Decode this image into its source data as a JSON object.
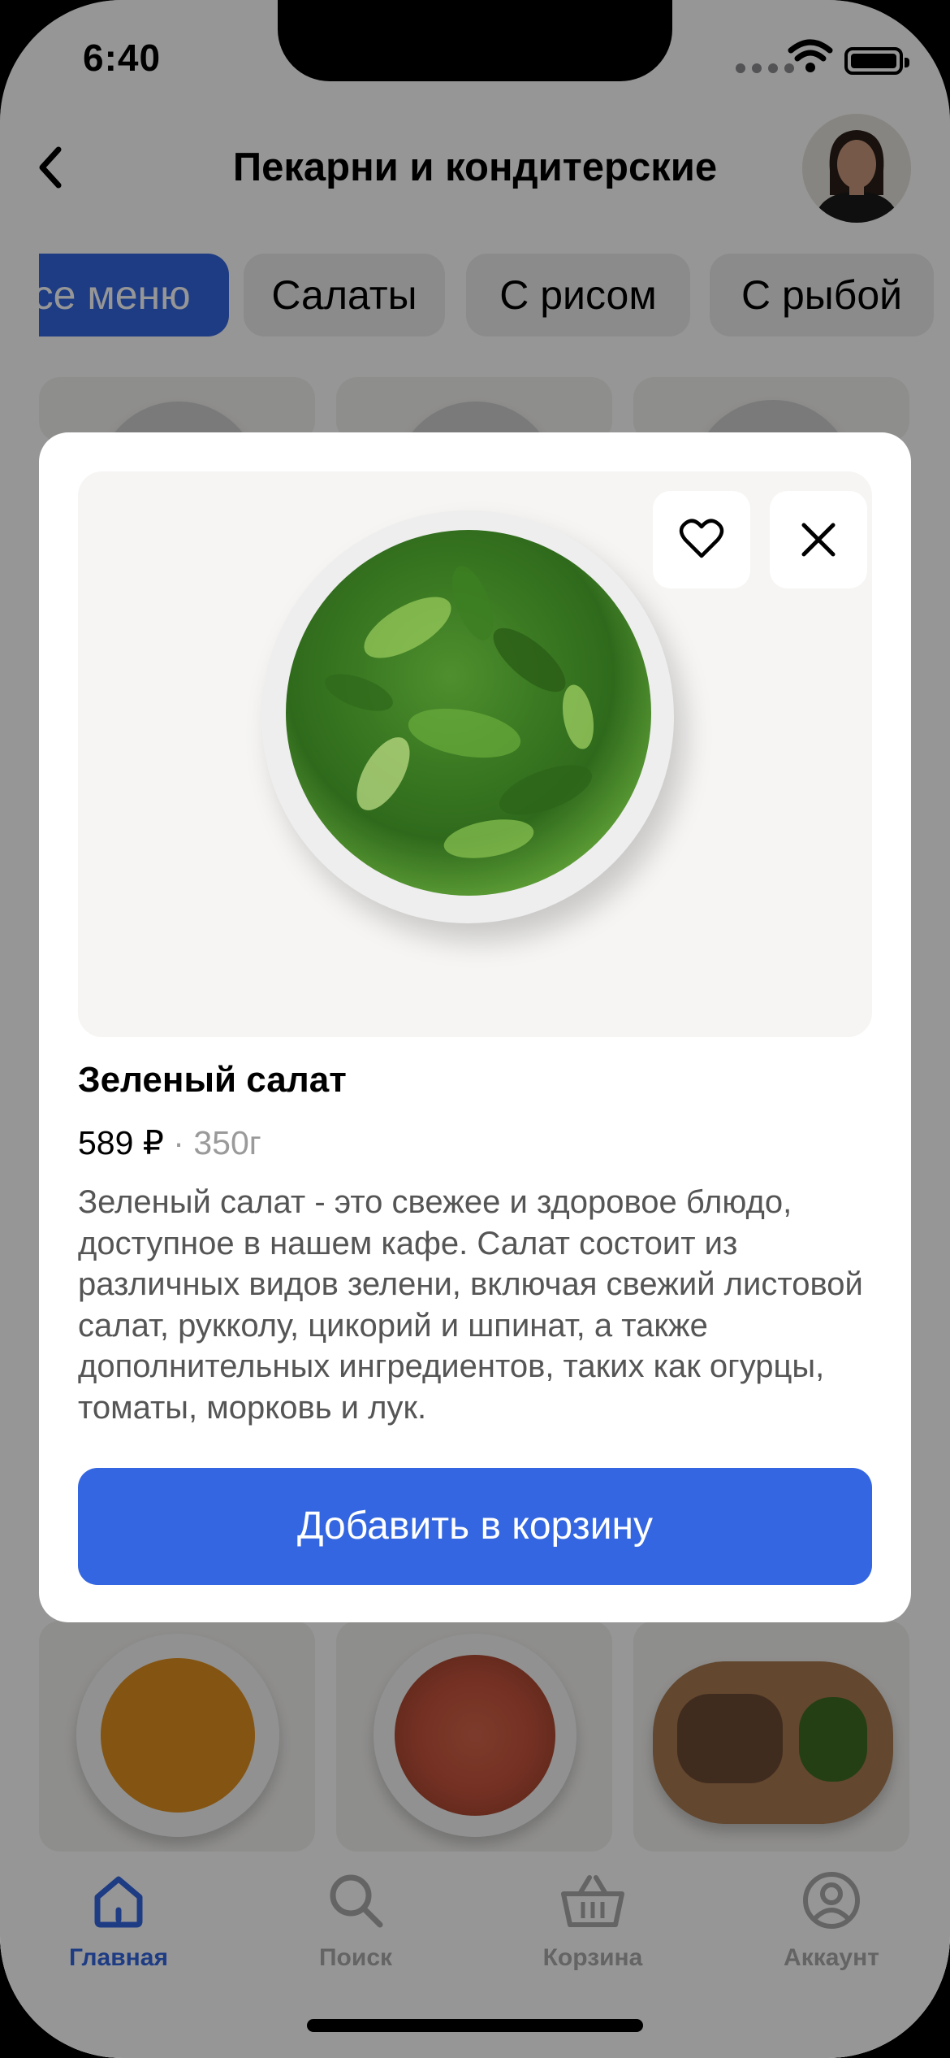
{
  "status_bar": {
    "time": "6:40"
  },
  "header": {
    "title": "Пекарни и кондитерские"
  },
  "categories": [
    {
      "label": "Все меню",
      "active": true
    },
    {
      "label": "Салаты",
      "active": false
    },
    {
      "label": "С рисом",
      "active": false
    },
    {
      "label": "С рыбой",
      "active": false
    }
  ],
  "modal": {
    "dish_name": "Зеленый салат",
    "price": "589 ₽",
    "separator": "·",
    "weight": "350г",
    "description": "Зеленый салат - это свежее и здоровое блюдо, доступное в нашем кафе. Салат состоит из различных видов зелени, включая свежий листовой салат, рукколу, цикорий и шпинат, а также дополнительных ингредиентов, таких как огурцы, томаты, морковь и лук.",
    "add_button": "Добавить в корзину"
  },
  "tabs": [
    {
      "label": "Главная",
      "icon": "home-icon",
      "active": true
    },
    {
      "label": "Поиск",
      "icon": "search-icon",
      "active": false
    },
    {
      "label": "Корзина",
      "icon": "basket-icon",
      "active": false
    },
    {
      "label": "Аккаунт",
      "icon": "account-icon",
      "active": false
    }
  ],
  "colors": {
    "accent": "#3366e0",
    "overlay": "rgba(0,0,0,0.41)"
  }
}
